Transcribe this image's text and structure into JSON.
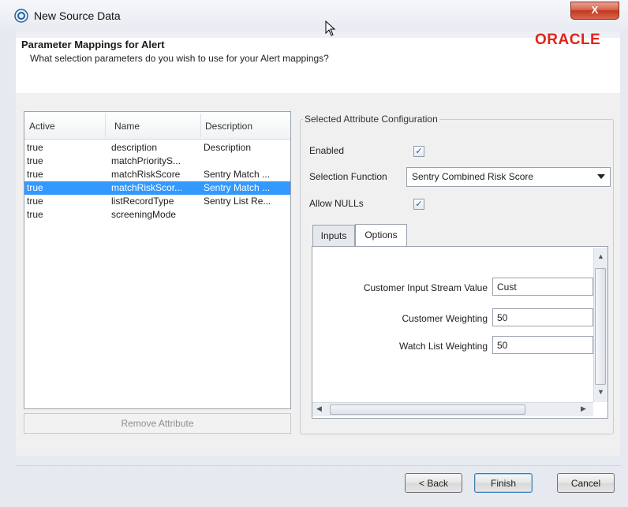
{
  "window": {
    "title": "New Source Data",
    "close_label": "X"
  },
  "header": {
    "title": "Parameter Mappings for Alert",
    "subtitle": "What selection parameters do you wish to use for your Alert mappings?",
    "brand": "ORACLE"
  },
  "table": {
    "columns": [
      "Active",
      "Name",
      "Description"
    ],
    "rows": [
      {
        "active": "true",
        "name": "description",
        "description": "Description"
      },
      {
        "active": "true",
        "name": "matchPriorityS...",
        "description": ""
      },
      {
        "active": "true",
        "name": "matchRiskScore",
        "description": "Sentry Match ..."
      },
      {
        "active": "true",
        "name": "matchRiskScor...",
        "description": "Sentry Match ..."
      },
      {
        "active": "true",
        "name": "listRecordType",
        "description": "Sentry List Re..."
      },
      {
        "active": "true",
        "name": "screeningMode",
        "description": ""
      }
    ],
    "selected_row": 3
  },
  "remove_button": "Remove Attribute",
  "config": {
    "group_title": "Selected Attribute Configuration",
    "enabled_label": "Enabled",
    "enabled_checked": true,
    "selection_function_label": "Selection Function",
    "selection_function_value": "Sentry Combined Risk Score",
    "allow_nulls_label": "Allow NULLs",
    "allow_nulls_checked": true,
    "check_mark": "✓",
    "tabs": [
      "Inputs",
      "Options"
    ],
    "active_tab": "Options",
    "fields": [
      {
        "label": "Customer Input Stream Value",
        "value": "Cust"
      },
      {
        "label": "Customer Weighting",
        "value": "50"
      },
      {
        "label": "Watch List Weighting",
        "value": "50"
      }
    ]
  },
  "footer": {
    "back": "< Back",
    "finish": "Finish",
    "cancel": "Cancel"
  },
  "colors": {
    "selection": "#3399ff",
    "brand": "#e2231a",
    "close": "#c2381e"
  }
}
